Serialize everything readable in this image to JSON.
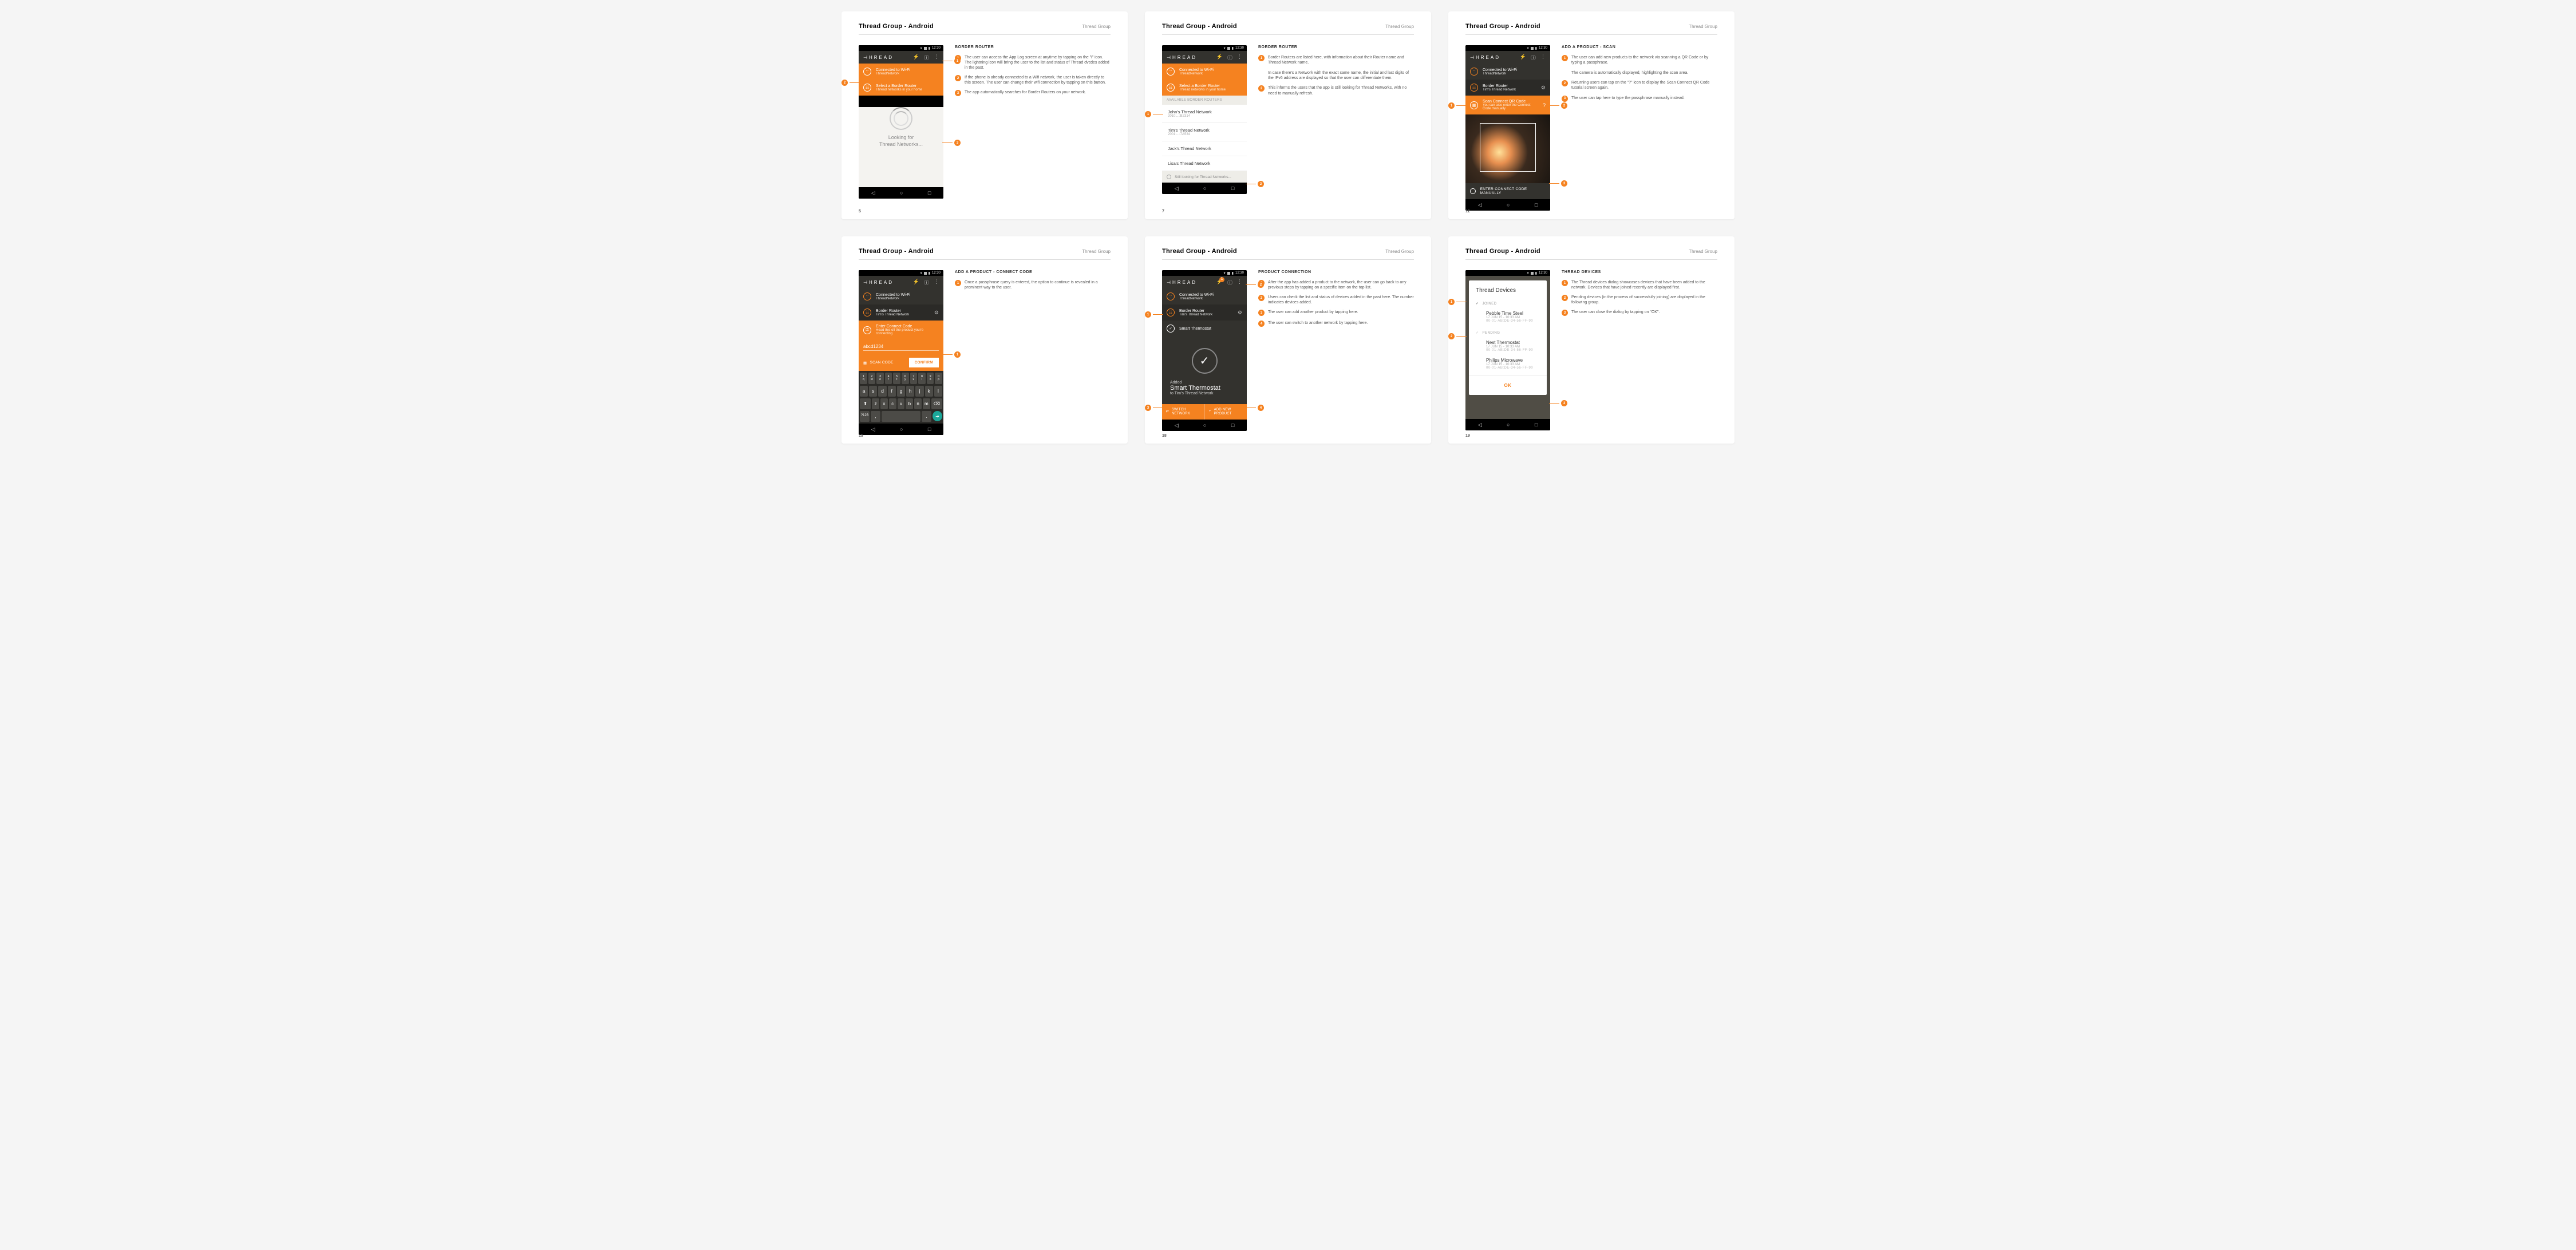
{
  "common": {
    "title": "Thread Group - Android",
    "brand": "Thread Group",
    "logo": "⊣HREAD",
    "time": "12:30",
    "wifi_title": "Connected to Wi-Fi",
    "wifi_sub": "ThreadNetwork",
    "border_title": "Border Router",
    "border_sub": "Tim's Thread Network"
  },
  "p1": {
    "num": "5",
    "notes_title": "BORDER ROUTER",
    "select_title": "Select a Border Router",
    "select_sub": "Thread networks in your home",
    "looking1": "Looking for",
    "looking2": "Thread Networks...",
    "n1": "The user can access the App Log screen at anytime by tapping on the \"i\" icon. The lightning icon will bring the user to the list and status of Thread dvcdes added in the past.",
    "n2": "If the phone is already connected to a Wifi network, the user is taken directly to this screen. The user can change their wifi connection by tapping on this button.",
    "n3": "The app automatically searches for Border Routers on your network."
  },
  "p2": {
    "num": "7",
    "notes_title": "BORDER ROUTER",
    "avail": "AVAILABLE BORDER ROUTERS",
    "r1": "John's Thread Network",
    "r1s": "2010:...:B2314",
    "r2": "Tim's Thread Network",
    "r2s": "2001:...:7A534",
    "r3": "Jack's Thread Network",
    "r4": "Lisa's Thread Network",
    "still": "Still looking for Thread Networks...",
    "n1": "Border Routers are listed here, with information about their Router name and Thread Network name.\n\nIn case there's a Network with the exact same name, the initial and last digits of the IPv6 address are displayed so that the user can differentiate them.",
    "n2": "This informs the users that the app is still looking for Thread Networks, with no need to manually refresh."
  },
  "p3": {
    "num": "12",
    "notes_title": "ADD A PRODUCT - SCAN",
    "scan_title": "Scan Connect QR Code",
    "scan_sub": "You can also enter the Connect Code manually",
    "manual": "ENTER CONNECT CODE MANUALLY",
    "n1": "The user can add new products to the network via scanning a QR Code or by typing a passphrase.\n\nThe camera is automatically displayed, highlighting the scan area.",
    "n2": "Returning users can tap on the \"?\" icon to display the Scan Connect QR Code tutorial screen again.",
    "n3": "The user can tap here to type the passphrase manually instead."
  },
  "p4": {
    "num": "15",
    "notes_title": "ADD A PRODUCT - CONNECT CODE",
    "enter_title": "Enter Connect Code",
    "enter_sub": "Read this off the product you're connecting",
    "input_val": "abcd1234",
    "scan_btn": "SCAN CODE",
    "confirm": "CONFIRM",
    "n1": "Once a passphrase query is entered, the option to continue is revealed in a prominent way to the user."
  },
  "p5": {
    "num": "18",
    "notes_title": "PRODUCT CONNECTION",
    "device": "Smart Thermostat",
    "added": "Added",
    "to": "to Tim's Thread Network",
    "switch": "SWITCH NETWORK",
    "addnew": "ADD NEW PRODUCT",
    "badge": "1",
    "n1": "After the app has added a product to the network, the user can go back to any previous steps by tapping on a specific item on the top list.",
    "n2": "Users can check the list and status of devices added in the past here. The number indicates devices added.",
    "n3": "The user can add another product by tapping here.",
    "n4": "The user can switch to another network by tapping here."
  },
  "p6": {
    "num": "19",
    "notes_title": "THREAD DEVICES",
    "dialog_title": "Thread Devices",
    "joined": "JOINED",
    "pending": "PENDING",
    "d1": "Pebble Time Steel",
    "d2": "Nest Thermostat",
    "d3": "Philips Microwave",
    "dt": "17 JUN 15 - 10:33 AM",
    "mac": "00-01-AB:DE-34-56-FF-90",
    "ok": "OK",
    "n1": "The Thread devices dialog showcases devices that have been added to the network. Devices that have joined recently are displayed first.",
    "n2": "Pending devices (in the process of successfully joining) are displayed in the following group.",
    "n3": "The user can close the dialog by tapping on \"OK\"."
  }
}
